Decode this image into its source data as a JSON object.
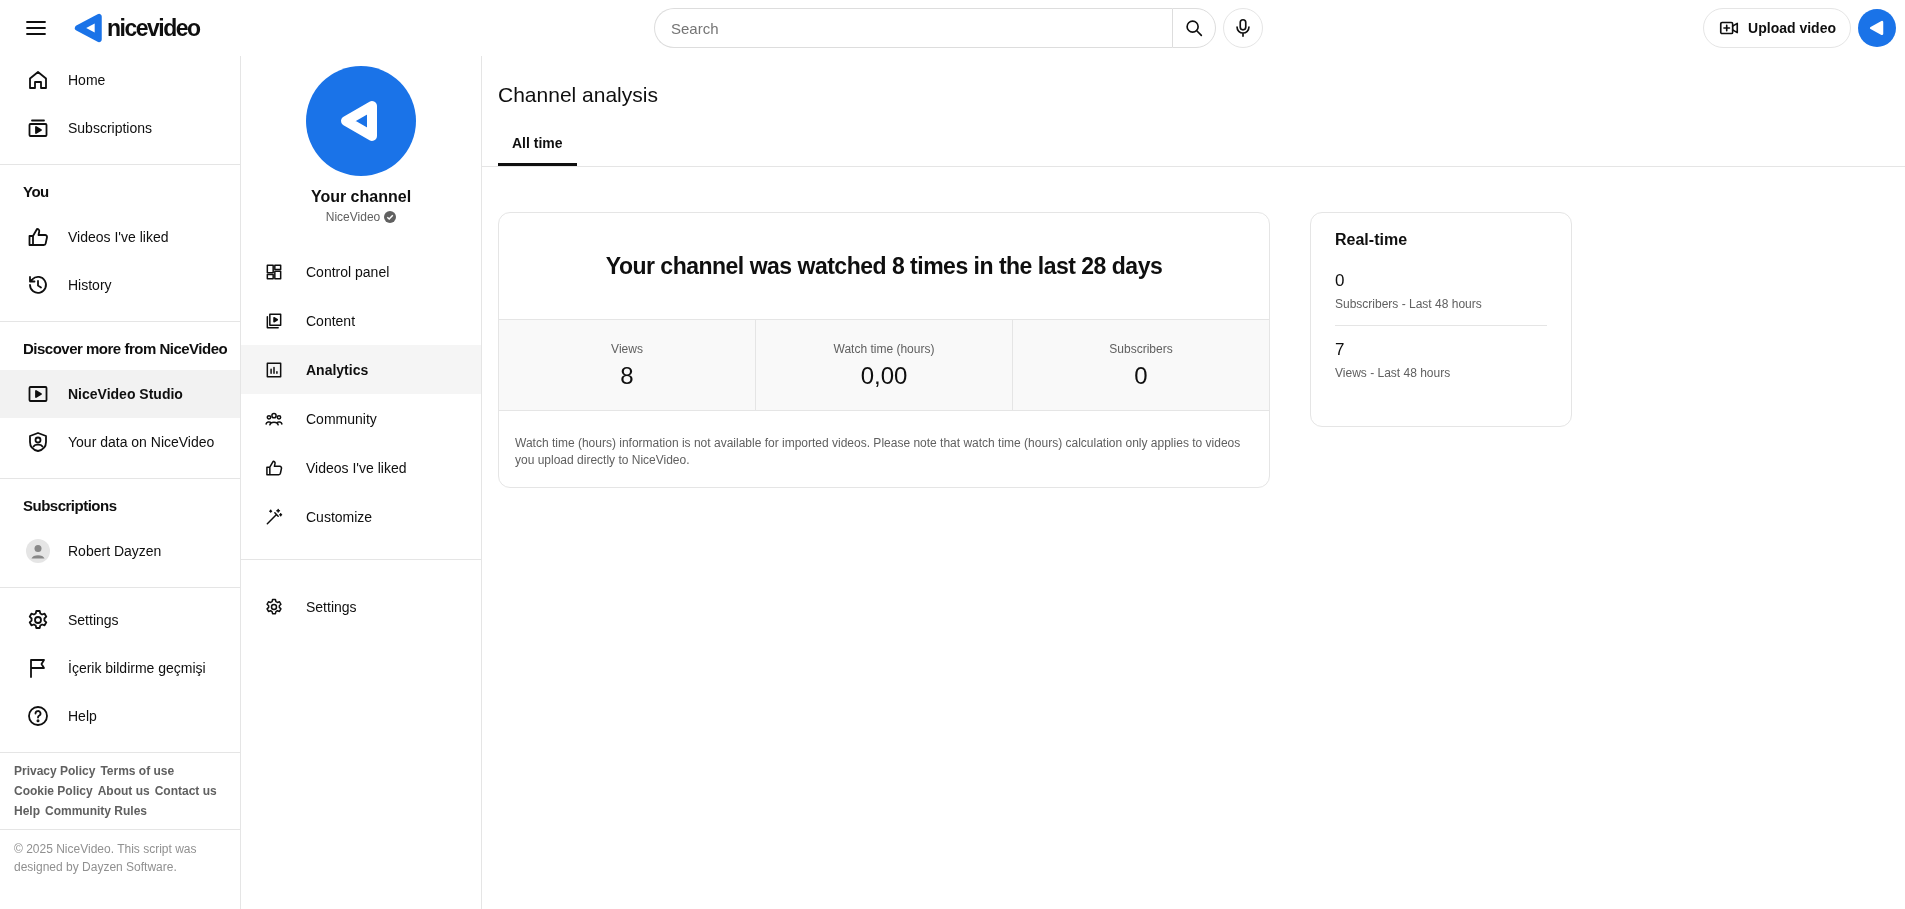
{
  "header": {
    "logo_text": "nicevideo",
    "search": {
      "placeholder": "Search"
    },
    "upload_button": "Upload video"
  },
  "sidebar": {
    "sections": [
      {
        "items": [
          {
            "kind": "page",
            "label": "Home",
            "selected": false
          },
          {
            "kind": "page",
            "label": "Subscriptions",
            "selected": false
          }
        ]
      },
      {
        "heading": "You",
        "items": [
          {
            "kind": "page",
            "label": "Videos I've liked",
            "selected": false
          },
          {
            "kind": "page",
            "label": "History",
            "selected": false
          }
        ]
      },
      {
        "heading": "Discover more from NiceVideo",
        "items": [
          {
            "kind": "page",
            "label": "NiceVideo Studio",
            "selected": true
          },
          {
            "kind": "page",
            "label": "Your data on NiceVideo",
            "selected": false
          }
        ]
      },
      {
        "heading": "Subscriptions",
        "items": [
          {
            "kind": "channel",
            "label": "Robert Dayzen",
            "selected": false
          }
        ]
      },
      {
        "items": [
          {
            "kind": "page",
            "label": "Settings",
            "selected": false
          },
          {
            "kind": "page",
            "label": "İçerik bildirme geçmişi",
            "selected": false
          },
          {
            "kind": "page",
            "label": "Help",
            "selected": false
          }
        ]
      }
    ],
    "footer_link_rows": [
      [
        "Privacy Policy",
        "Terms of use"
      ],
      [
        "Cookie Policy",
        "About us",
        "Contact us"
      ],
      [
        "Help",
        "Community Rules"
      ]
    ],
    "copyright": "© 2025 NiceVideo. This script was designed by Dayzen Software."
  },
  "channel": {
    "name": "Your channel",
    "handle": "NiceVideo",
    "verified": true
  },
  "studio_nav": {
    "items": [
      {
        "label": "Control panel",
        "selected": false
      },
      {
        "label": "Content",
        "selected": false
      },
      {
        "label": "Analytics",
        "selected": true
      },
      {
        "label": "Community",
        "selected": false
      },
      {
        "label": "Videos I've liked",
        "selected": false
      },
      {
        "label": "Customize",
        "selected": false
      }
    ],
    "bottom_items": [
      {
        "label": "Settings",
        "selected": false
      }
    ]
  },
  "page": {
    "title": "Channel analysis",
    "tabs": [
      {
        "label": "All time",
        "selected": true
      }
    ]
  },
  "summary_card": {
    "headline": "Your channel was watched 8 times in the last 28 days",
    "stats": [
      {
        "label": "Views",
        "value": "8"
      },
      {
        "label": "Watch time (hours)",
        "value": "0,00"
      },
      {
        "label": "Subscribers",
        "value": "0"
      }
    ],
    "note": "Watch time (hours) information is not available for imported videos. Please note that watch time (hours) calculation only applies to videos you upload directly to NiceVideo."
  },
  "realtime_card": {
    "title": "Real-time",
    "metrics": [
      {
        "value": "0",
        "label": "Subscribers - Last 48 hours"
      },
      {
        "value": "7",
        "label": "Views - Last 48 hours"
      }
    ]
  }
}
